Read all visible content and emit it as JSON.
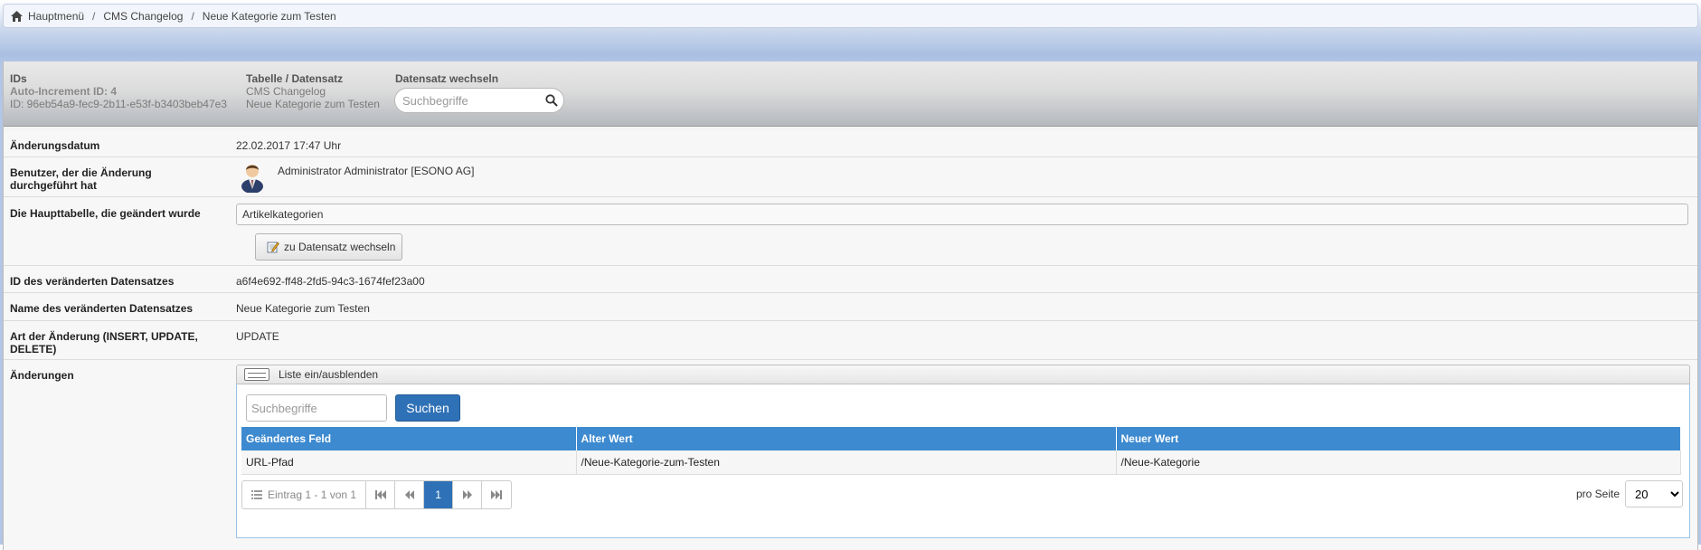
{
  "breadcrumb": {
    "items": [
      "Hauptmenü",
      "CMS Changelog",
      "Neue Kategorie zum Testen"
    ],
    "separator": "/"
  },
  "header": {
    "ids": {
      "title": "IDs",
      "auto_increment": "Auto-Increment ID: 4",
      "id": "ID: 96eb54a9-fec9-2b11-e53f-b3403beb47e3"
    },
    "table": {
      "title": "Tabelle / Datensatz",
      "table_name": "CMS Changelog",
      "record_name": "Neue Kategorie zum Testen"
    },
    "switch": {
      "title": "Datensatz wechseln",
      "placeholder": "Suchbegriffe"
    }
  },
  "fields": {
    "change_date": {
      "label": "Änderungsdatum",
      "value": "22.02.2017 17:47 Uhr"
    },
    "user": {
      "label": "Benutzer, der die Änderung durchgeführt hat",
      "value": "Administrator Administrator [ESONO AG]"
    },
    "main_table": {
      "label": "Die Haupttabelle, die geändert wurde",
      "value": "Artikelkategorien",
      "button": "zu Datensatz wechseln"
    },
    "record_id": {
      "label": "ID des veränderten Datensatzes",
      "value": "a6f4e692-ff48-2fd5-94c3-1674fef23a00"
    },
    "record_name": {
      "label": "Name des veränderten Datensatzes",
      "value": "Neue Kategorie zum Testen"
    },
    "change_type": {
      "label": "Art der Änderung (INSERT, UPDATE, DELETE)",
      "value": "UPDATE"
    },
    "changes": {
      "label": "Änderungen"
    }
  },
  "changes_list": {
    "toggle_label": "Liste ein/ausblenden",
    "search_placeholder": "Suchbegriffe",
    "search_button": "Suchen",
    "columns": [
      "Geändertes Feld",
      "Alter Wert",
      "Neuer Wert"
    ],
    "rows": [
      [
        "URL-Pfad",
        "/Neue-Kategorie-zum-Testen",
        "/Neue-Kategorie"
      ]
    ],
    "pager": {
      "info": "Eintrag 1 - 1 von 1",
      "current_page": "1",
      "first": "⏮",
      "prev": "⏪",
      "next": "⏩",
      "last": "⏭"
    },
    "per_page": {
      "label": "pro Seite",
      "value": "20"
    }
  },
  "colors": {
    "accent": "#2f71b6",
    "table_header": "#3d8ad0"
  }
}
